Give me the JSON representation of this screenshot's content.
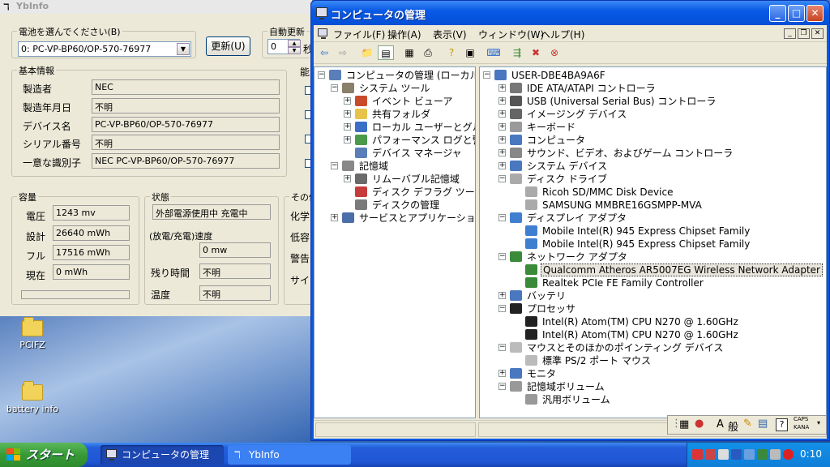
{
  "desktop": {
    "icons": [
      {
        "label": "PCIFZ"
      },
      {
        "label": "battery info"
      }
    ]
  },
  "ybinfo": {
    "title": "YbInfo",
    "battery_select_label": "電池を選んでください(B)",
    "battery_select_value": "0: PC-VP-BP60/OP-570-76977",
    "refresh_button": "更新(U)",
    "auto_update_label": "自動更新",
    "auto_update_value": "0",
    "auto_update_unit": "秒",
    "right_group_label": "能",
    "basic": {
      "label": "基本情報",
      "rows": [
        {
          "label": "製造者",
          "value": "NEC"
        },
        {
          "label": "製造年月日",
          "value": "不明"
        },
        {
          "label": "デバイス名",
          "value": "PC-VP-BP60/OP-570-76977"
        },
        {
          "label": "シリアル番号",
          "value": "不明"
        },
        {
          "label": "一意な識別子",
          "value": "NEC  PC-VP-BP60/OP-570-76977"
        }
      ]
    },
    "capacity": {
      "label": "容量",
      "rows": [
        {
          "label": "電圧",
          "value": "1243 mv"
        },
        {
          "label": "設計",
          "value": "26640 mWh"
        },
        {
          "label": "フル",
          "value": "17516 mWh"
        },
        {
          "label": "現在",
          "value": "0 mWh"
        }
      ]
    },
    "status": {
      "label": "状態",
      "state_value": "外部電源使用中 充電中",
      "rate_label": "(放電/充電)速度",
      "rate_value": "0 mw",
      "remaining_label": "残り時間",
      "remaining_value": "不明",
      "temp_label": "温度",
      "temp_value": "不明"
    },
    "other": {
      "label": "その他",
      "rows": [
        "化学",
        "低容",
        "警告",
        "サイ"
      ]
    }
  },
  "mgmt": {
    "title": "コンピュータの管理",
    "menus": [
      "ファイル(F)",
      "操作(A)",
      "表示(V)",
      "ウィンドウ(W)",
      "ヘルプ(H)"
    ],
    "left_tree": [
      {
        "label": "コンピュータの管理 (ローカル)",
        "level": 0,
        "exp": "-",
        "icon": "computer-management-icon"
      },
      {
        "label": "システム ツール",
        "level": 1,
        "exp": "-",
        "icon": "system-tools-icon"
      },
      {
        "label": "イベント ビューア",
        "level": 2,
        "exp": "+",
        "icon": "event-viewer-icon"
      },
      {
        "label": "共有フォルダ",
        "level": 2,
        "exp": "+",
        "icon": "shared-folder-icon"
      },
      {
        "label": "ローカル ユーザーとグループ",
        "level": 2,
        "exp": "+",
        "icon": "users-groups-icon"
      },
      {
        "label": "パフォーマンス ログと警告",
        "level": 2,
        "exp": "+",
        "icon": "performance-icon"
      },
      {
        "label": "デバイス マネージャ",
        "level": 2,
        "exp": "",
        "icon": "device-manager-icon"
      },
      {
        "label": "記憶域",
        "level": 1,
        "exp": "-",
        "icon": "storage-icon"
      },
      {
        "label": "リムーバブル記憶域",
        "level": 2,
        "exp": "+",
        "icon": "removable-storage-icon"
      },
      {
        "label": "ディスク デフラグ ツール",
        "level": 2,
        "exp": "",
        "icon": "defrag-icon"
      },
      {
        "label": "ディスクの管理",
        "level": 2,
        "exp": "",
        "icon": "disk-management-icon"
      },
      {
        "label": "サービスとアプリケーション",
        "level": 1,
        "exp": "+",
        "icon": "services-icon"
      }
    ],
    "right_tree": [
      {
        "label": "USER-DBE4BA9A6F",
        "level": 0,
        "exp": "-",
        "icon": "computer-icon"
      },
      {
        "label": "IDE ATA/ATAPI コントローラ",
        "level": 1,
        "exp": "+",
        "icon": "ide-icon"
      },
      {
        "label": "USB (Universal Serial Bus) コントローラ",
        "level": 1,
        "exp": "+",
        "icon": "usb-icon"
      },
      {
        "label": "イメージング デバイス",
        "level": 1,
        "exp": "+",
        "icon": "camera-icon"
      },
      {
        "label": "キーボード",
        "level": 1,
        "exp": "+",
        "icon": "keyboard-icon"
      },
      {
        "label": "コンピュータ",
        "level": 1,
        "exp": "+",
        "icon": "computer-icon"
      },
      {
        "label": "サウンド、ビデオ、およびゲーム コントローラ",
        "level": 1,
        "exp": "+",
        "icon": "sound-icon"
      },
      {
        "label": "システム デバイス",
        "level": 1,
        "exp": "+",
        "icon": "system-device-icon"
      },
      {
        "label": "ディスク ドライブ",
        "level": 1,
        "exp": "-",
        "icon": "disk-drive-icon"
      },
      {
        "label": "Ricoh SD/MMC Disk Device",
        "level": 2,
        "exp": "",
        "icon": "disk-drive-icon"
      },
      {
        "label": "SAMSUNG MMBRE16GSMPP-MVA",
        "level": 2,
        "exp": "",
        "icon": "disk-drive-icon"
      },
      {
        "label": "ディスプレイ アダプタ",
        "level": 1,
        "exp": "-",
        "icon": "display-icon"
      },
      {
        "label": "Mobile Intel(R) 945 Express Chipset Family",
        "level": 2,
        "exp": "",
        "icon": "display-icon"
      },
      {
        "label": "Mobile Intel(R) 945 Express Chipset Family",
        "level": 2,
        "exp": "",
        "icon": "display-icon"
      },
      {
        "label": "ネットワーク アダプタ",
        "level": 1,
        "exp": "-",
        "icon": "network-icon"
      },
      {
        "label": "Qualcomm Atheros AR5007EG Wireless Network Adapter",
        "level": 2,
        "exp": "",
        "icon": "network-icon",
        "selected": true
      },
      {
        "label": "Realtek PCIe FE Family Controller",
        "level": 2,
        "exp": "",
        "icon": "network-icon"
      },
      {
        "label": "バッテリ",
        "level": 1,
        "exp": "+",
        "icon": "battery-icon"
      },
      {
        "label": "プロセッサ",
        "level": 1,
        "exp": "-",
        "icon": "processor-icon"
      },
      {
        "label": "Intel(R) Atom(TM) CPU N270   @ 1.60GHz",
        "level": 2,
        "exp": "",
        "icon": "processor-icon"
      },
      {
        "label": "Intel(R) Atom(TM) CPU N270   @ 1.60GHz",
        "level": 2,
        "exp": "",
        "icon": "processor-icon"
      },
      {
        "label": "マウスとそのほかのポインティング デバイス",
        "level": 1,
        "exp": "-",
        "icon": "mouse-icon"
      },
      {
        "label": "標準 PS/2 ポート マウス",
        "level": 2,
        "exp": "",
        "icon": "mouse-icon"
      },
      {
        "label": "モニタ",
        "level": 1,
        "exp": "+",
        "icon": "monitor-icon"
      },
      {
        "label": "記憶域ボリューム",
        "level": 1,
        "exp": "-",
        "icon": "volume-icon"
      },
      {
        "label": "汎用ボリューム",
        "level": 2,
        "exp": "",
        "icon": "volume-icon"
      }
    ]
  },
  "language_bar": {
    "mode_a": "A",
    "mode_text": "般",
    "caps": "CAPS",
    "kana": "KANA"
  },
  "taskbar": {
    "start": "スタート",
    "tasks": [
      "コンピュータの管理",
      "YbInfo"
    ],
    "clock": "0:10"
  },
  "icon_colors": {
    "computer-management-icon": "#5a7fb8",
    "system-tools-icon": "#8a7f6a",
    "event-viewer-icon": "#c94a2a",
    "shared-folder-icon": "#e8c34a",
    "users-groups-icon": "#3b6fc6",
    "performance-icon": "#4a9a4a",
    "device-manager-icon": "#5a7fb8",
    "storage-icon": "#888888",
    "removable-storage-icon": "#6a6a6a",
    "defrag-icon": "#c63b3b",
    "disk-management-icon": "#7a7a7a",
    "services-icon": "#4a6fa8",
    "computer-icon": "#4a78c0",
    "ide-icon": "#777777",
    "usb-icon": "#555555",
    "camera-icon": "#666666",
    "keyboard-icon": "#9a9a9a",
    "sound-icon": "#888888",
    "system-device-icon": "#4a78c0",
    "disk-drive-icon": "#aaaaaa",
    "display-icon": "#3f7fd0",
    "network-icon": "#3a8a3a",
    "battery-icon": "#4a78c0",
    "processor-icon": "#222222",
    "mouse-icon": "#bbbbbb",
    "monitor-icon": "#4a78c0",
    "volume-icon": "#999999"
  }
}
